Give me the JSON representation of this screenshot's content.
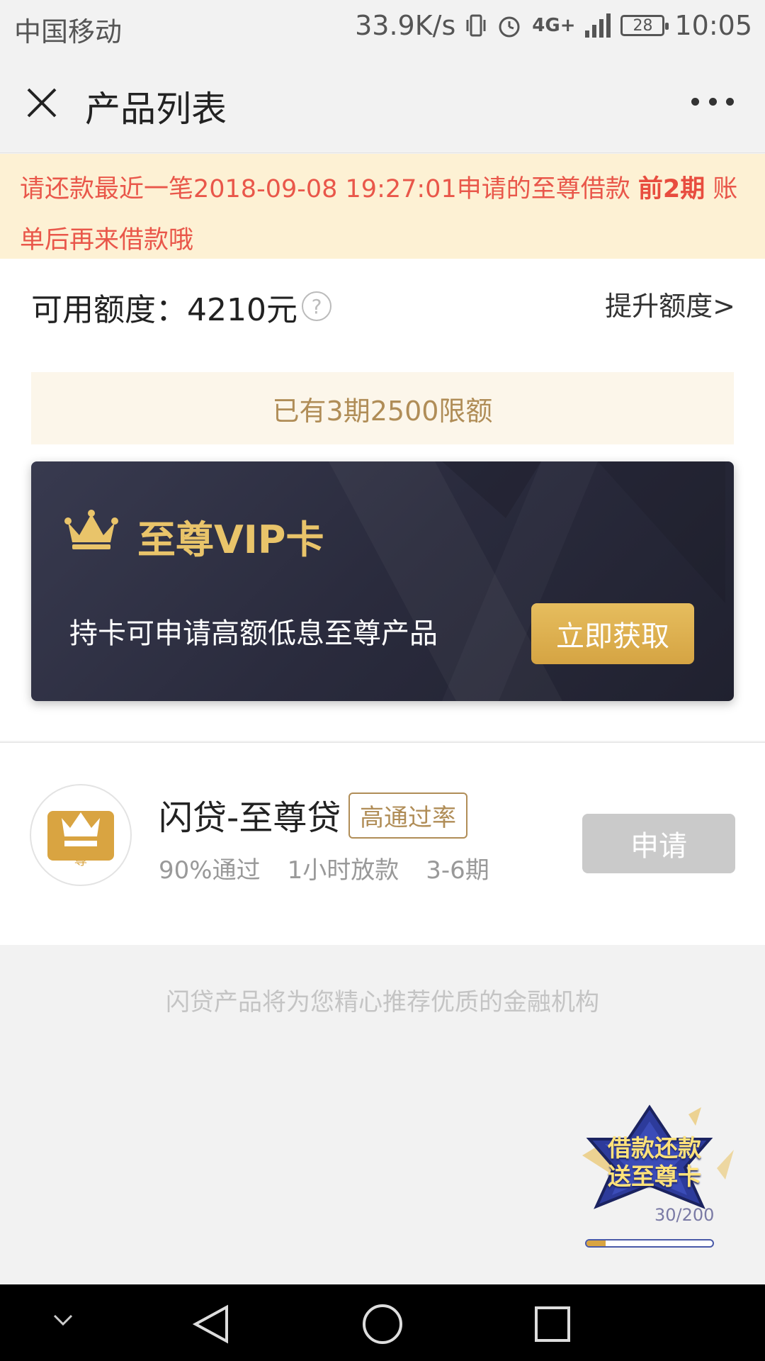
{
  "status_bar": {
    "carrier": "中国移动",
    "speed": "33.9K/s",
    "network": "4G+",
    "battery": "28",
    "time": "10:05"
  },
  "nav": {
    "title": "产品列表"
  },
  "notice": {
    "text_before": "请还款最近一笔2018-09-08 19:27:01申请的至尊借款 ",
    "text_bold": "前2期",
    "text_after": " 账单后再来借款哦"
  },
  "quota": {
    "label": "可用额度：4210元",
    "help_glyph": "?",
    "raise_link": "提升额度>"
  },
  "limit_bar": {
    "text": "已有3期2500限额"
  },
  "vip_card": {
    "title": "至尊VIP卡",
    "description": "持卡可申请高额低息至尊产品",
    "button": "立即获取"
  },
  "product": {
    "logo_glyph": "尊",
    "name": "闪贷-至尊贷",
    "tag": "高通过率",
    "meta": [
      "90%通过",
      "1小时放款",
      "3-6期"
    ],
    "apply_button": "申请"
  },
  "footer": {
    "text": "闪贷产品将为您精心推荐优质的金融机构"
  },
  "float_badge": {
    "line1": "借款还款",
    "line2": "送至尊卡",
    "count": "30/200",
    "progress": 0.15
  },
  "colors": {
    "notice_bg": "#fdf1d4",
    "notice_text": "#e9574a",
    "gold": "#b08d57",
    "vip_title": "#e9c46a",
    "vip_button": "#d5a443",
    "disabled_button": "#cacaca"
  }
}
